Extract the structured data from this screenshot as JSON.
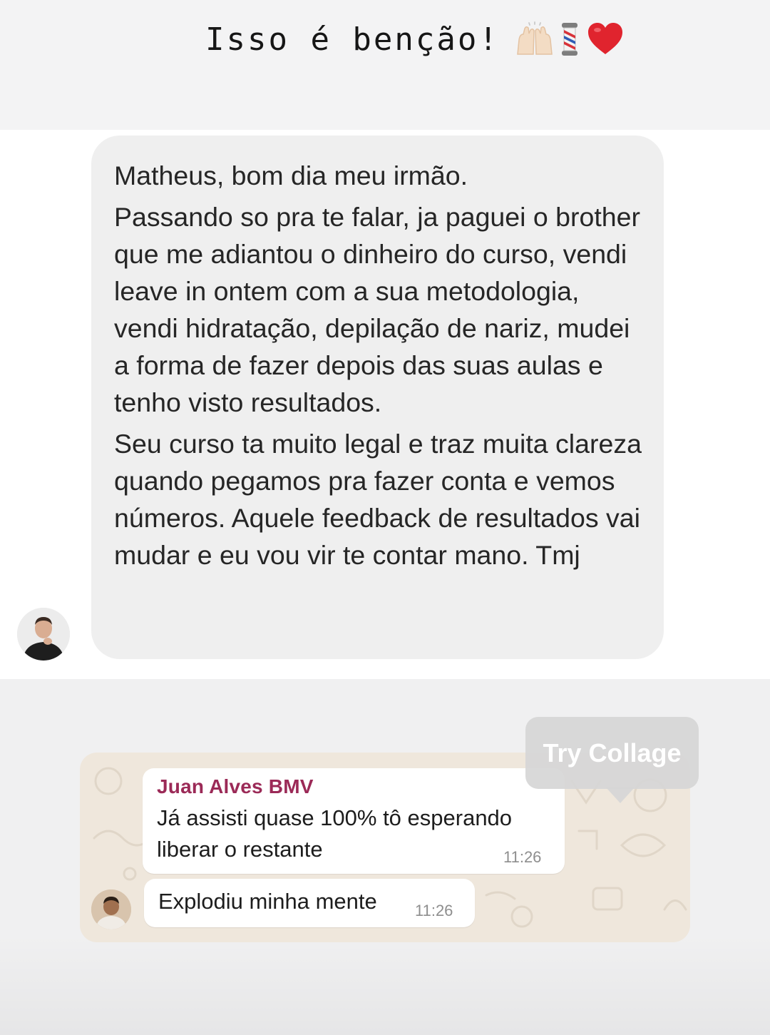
{
  "story": {
    "caption_text": "Isso é benção!",
    "caption_emojis": [
      "raising-hands-emoji",
      "barber-pole-emoji",
      "red-heart-emoji"
    ]
  },
  "instagram_dm": {
    "message_paragraphs": [
      "Matheus, bom dia meu irmão.",
      "Passando so pra te falar, ja paguei o brother que me adiantou o dinheiro do curso, vendi leave in ontem com a sua metodologia, vendi hidratação, depilação de nariz, mudei a forma de fazer depois das suas aulas e tenho visto resultados.",
      "Seu curso ta muito legal e traz muita clareza quando pegamos pra fazer conta e vemos números. Aquele feedback de resultados vai mudar e eu vou vir te contar mano. Tmj"
    ],
    "bubble_color": "#efefef"
  },
  "whatsapp": {
    "messages": [
      {
        "sender": "Juan Alves BMV",
        "text": "Já assisti quase 100% tô esperando liberar o restante",
        "time": "11:26"
      },
      {
        "text": "Explodiu minha mente",
        "time": "11:26"
      }
    ],
    "sender_color": "#9b2a57",
    "background_color": "#efe7dc"
  },
  "overlay": {
    "try_collage_label": "Try Collage"
  }
}
